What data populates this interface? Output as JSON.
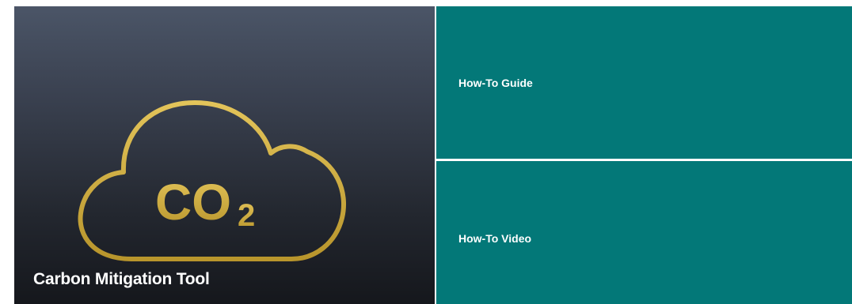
{
  "hero": {
    "title": "Carbon Mitigation Tool",
    "icon": "co2-cloud-icon",
    "icon_text_main": "CO",
    "icon_text_sub": "2",
    "icon_color": "#c9a93c"
  },
  "tiles": [
    {
      "label": "How-To Guide",
      "color": "#037878"
    },
    {
      "label": "How-To Video",
      "color": "#037878"
    }
  ]
}
